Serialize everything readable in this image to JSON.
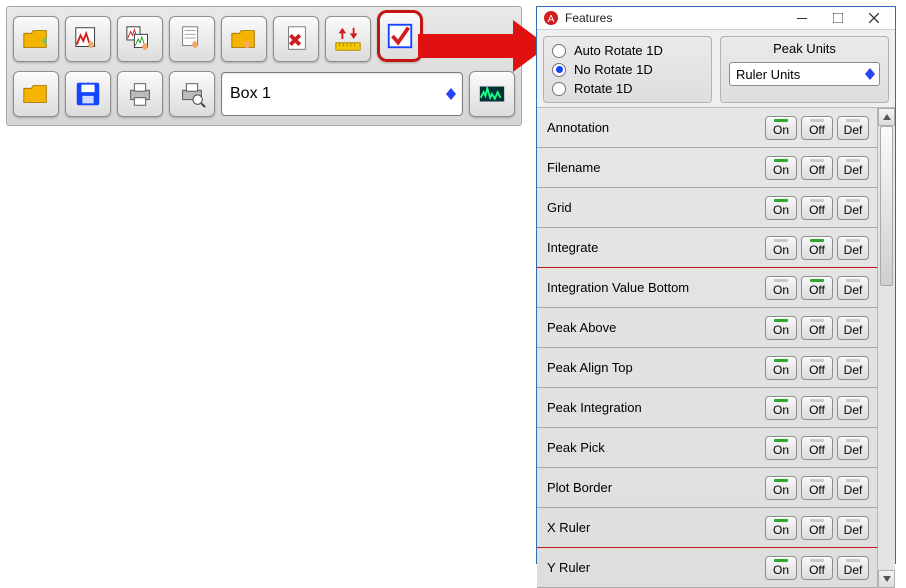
{
  "toolbar": {
    "row1_icons": [
      "folder-open-icon",
      "chart-open-icon",
      "chart-open-dual-icon",
      "page-hand-icon",
      "folder-hand-icon",
      "page-delete-icon",
      "ruler-arrows-icon",
      "checkbox-icon"
    ],
    "row2_icons": [
      "open-icon",
      "save-icon",
      "print-icon",
      "print-preview-icon"
    ],
    "combo_value": "Box 1",
    "right_button_icon": "waveform-icon"
  },
  "features_window": {
    "title": "Features",
    "rotate_options": [
      {
        "label": "Auto Rotate 1D",
        "checked": false
      },
      {
        "label": "No Rotate 1D",
        "checked": true
      },
      {
        "label": "Rotate 1D",
        "checked": false
      }
    ],
    "peak_units_label": "Peak Units",
    "units_combo_value": "Ruler Units",
    "btn_on": "On",
    "btn_off": "Off",
    "btn_def": "Def",
    "rows": [
      {
        "label": "Annotation",
        "active": "on",
        "sep": false
      },
      {
        "label": "Filename",
        "active": "on",
        "sep": false
      },
      {
        "label": "Grid",
        "active": "on",
        "sep": false
      },
      {
        "label": "Integrate",
        "active": "off",
        "sep": true
      },
      {
        "label": "Integration Value Bottom",
        "active": "off",
        "sep": false
      },
      {
        "label": "Peak Above",
        "active": "on",
        "sep": false
      },
      {
        "label": "Peak Align Top",
        "active": "on",
        "sep": false
      },
      {
        "label": "Peak Integration",
        "active": "on",
        "sep": false
      },
      {
        "label": "Peak Pick",
        "active": "on",
        "sep": false
      },
      {
        "label": "Plot Border",
        "active": "on",
        "sep": false
      },
      {
        "label": "X Ruler",
        "active": "on",
        "sep": true
      },
      {
        "label": "Y Ruler",
        "active": "on",
        "sep": false
      }
    ]
  },
  "colors": {
    "folder": "#f5b400",
    "page": "#fff",
    "hand": "#f2a96a",
    "ruler": "#f6c800",
    "red": "#d21d1d",
    "green": "#2fa82f",
    "blue": "#1545ff",
    "iconbg": "#dedede"
  }
}
